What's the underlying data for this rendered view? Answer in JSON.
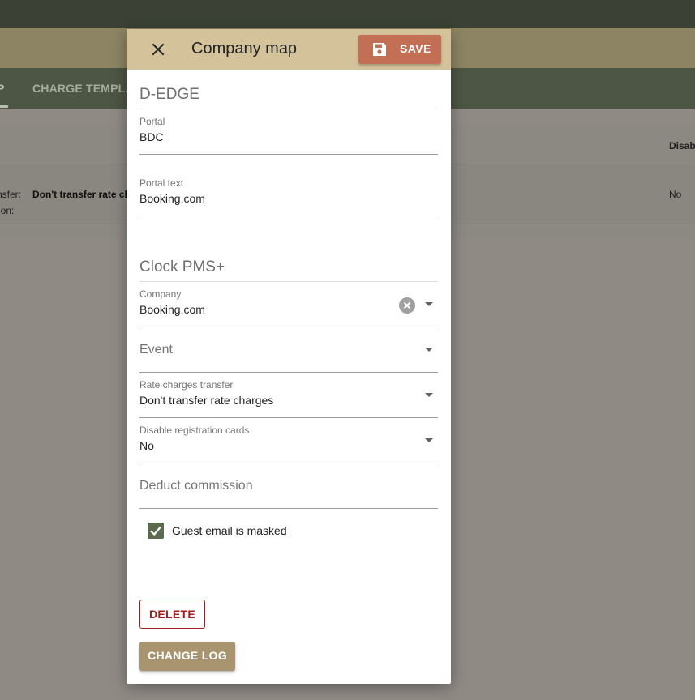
{
  "background": {
    "tabs": [
      {
        "label": "P"
      },
      {
        "label": "CHARGE TEMPLAT"
      }
    ],
    "table": {
      "header_right": "Disabl",
      "row": {
        "label1": "nsfer:",
        "value1": "Don't transfer rate cl",
        "label2": "ion:",
        "disabled_value": "No"
      }
    }
  },
  "dialog": {
    "title": "Company map",
    "save_label": "SAVE",
    "sections": {
      "source": "D-EDGE",
      "target": "Clock PMS+"
    },
    "fields": {
      "portal": {
        "label": "Portal",
        "value": "BDC"
      },
      "portal_text": {
        "label": "Portal text",
        "value": "Booking.com"
      },
      "company": {
        "label": "Company",
        "value": "Booking.com"
      },
      "event": {
        "placeholder": "Event"
      },
      "rate_charges_transfer": {
        "label": "Rate charges transfer",
        "value": "Don't transfer rate charges"
      },
      "disable_registration_cards": {
        "label": "Disable registration cards",
        "value": "No"
      },
      "deduct_commission": {
        "placeholder": "Deduct commission"
      }
    },
    "guest_email_masked": {
      "label": "Guest email is masked",
      "checked": true
    },
    "delete_label": "DELETE",
    "change_log_label": "CHANGE LOG"
  },
  "colors": {
    "header_bg": "#d4c29b",
    "save_bg": "#c26f56",
    "delete_color": "#a31f1f",
    "changelog_bg": "#a89570",
    "checkbox_bg": "#5a6b4f"
  },
  "icons": {
    "close": "close-icon",
    "save": "floppy-disk-icon",
    "clear": "clear-circle-icon",
    "dropdown": "chevron-down-icon",
    "check": "check-icon"
  }
}
